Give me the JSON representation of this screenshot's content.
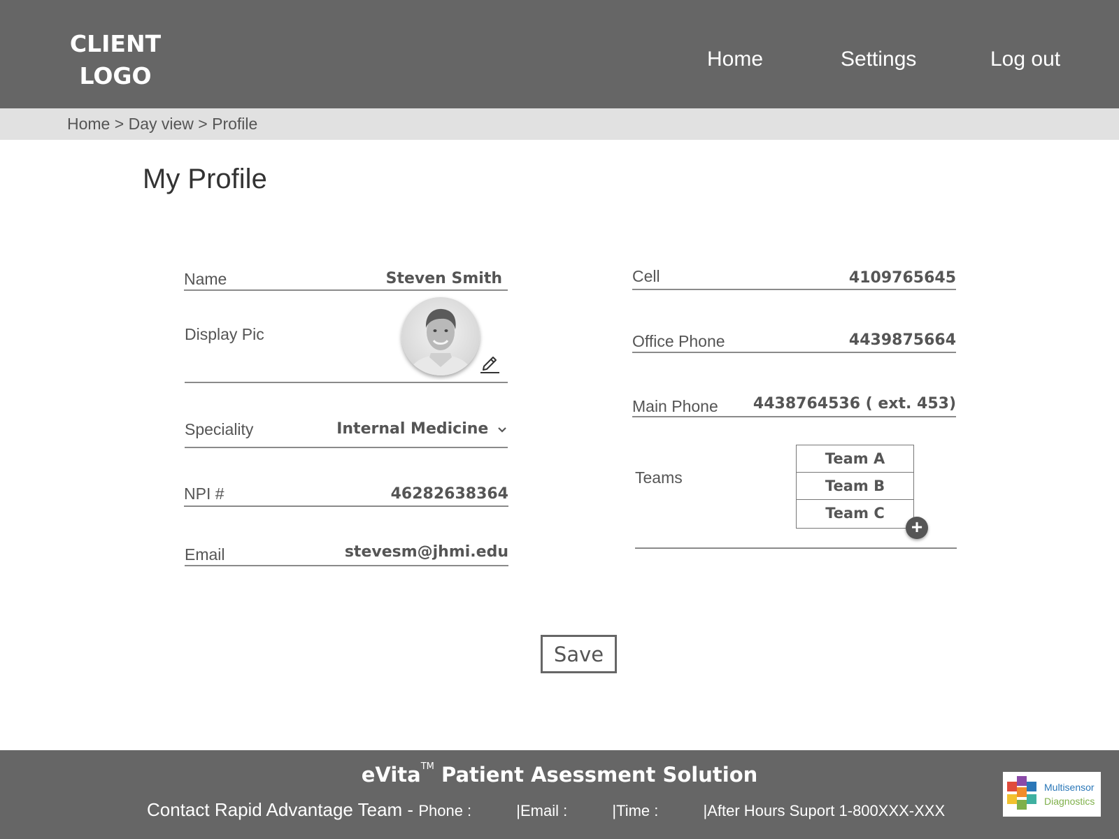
{
  "header": {
    "logo_line1": "CLIENT",
    "logo_line2": "LOGO",
    "nav": {
      "home": "Home",
      "settings": "Settings",
      "logout": "Log out"
    }
  },
  "breadcrumb": {
    "items": [
      "Home",
      "Day view",
      "Profile"
    ],
    "separator": ">"
  },
  "page_title": "My Profile",
  "profile": {
    "name": {
      "label": "Name",
      "value": "Steven Smith"
    },
    "display_pic": {
      "label": "Display Pic"
    },
    "speciality": {
      "label": "Speciality",
      "value": "Internal Medicine"
    },
    "npi": {
      "label": "NPI #",
      "value": "46282638364"
    },
    "email": {
      "label": "Email",
      "value": "stevesm@jhmi.edu"
    },
    "cell": {
      "label": "Cell",
      "value": "4109765645"
    },
    "office_phone": {
      "label": "Office Phone",
      "value": "4439875664"
    },
    "main_phone": {
      "label": "Main Phone",
      "value": "4438764536 ( ext. 453)"
    },
    "teams": {
      "label": "Teams",
      "items": [
        "Team A",
        "Team B",
        "Team C"
      ]
    }
  },
  "save_label": "Save",
  "footer": {
    "title_brand": "eVita",
    "title_tm": "TM",
    "title_rest": " Patient Asessment Solution",
    "contact_lead": "Contact Rapid Advantage Team - ",
    "phone": "Phone :",
    "email": "|Email :",
    "time": "|Time :",
    "after_hours": "|After Hours Suport 1-800XXX-XXX",
    "partner_line1": "Multisensor",
    "partner_line2": "Diagnostics"
  },
  "colors": {
    "header_bg": "#666666",
    "breadcrumb_bg": "#e1e1e1",
    "text": "#555555"
  }
}
